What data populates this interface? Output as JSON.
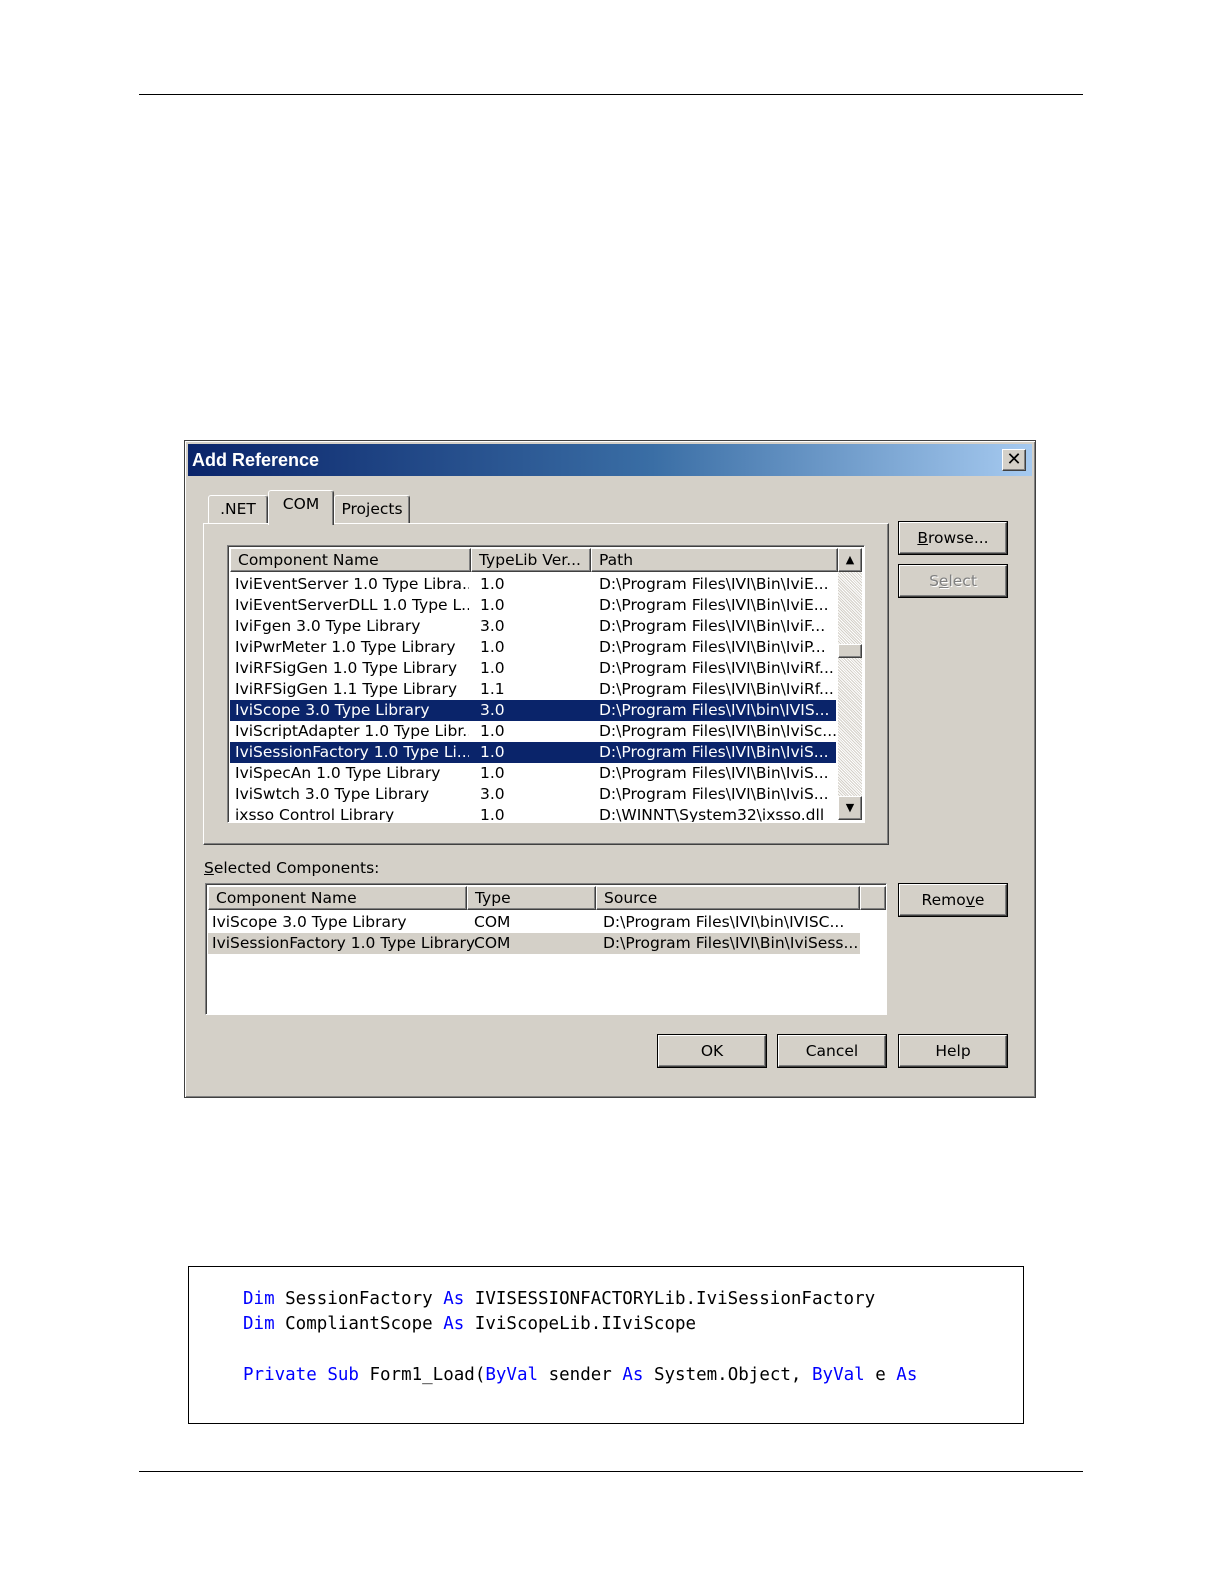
{
  "dialog": {
    "title": "Add Reference",
    "close_glyph": "✕",
    "tabs": [
      {
        "label": ".NET"
      },
      {
        "label": "COM"
      },
      {
        "label": "Projects"
      }
    ],
    "components": {
      "columns": [
        "Component Name",
        "TypeLib Ver...",
        "Path"
      ],
      "rows": [
        {
          "name": "IviEventServer 1.0 Type Libra...",
          "ver": "1.0",
          "path": "D:\\Program Files\\IVI\\Bin\\IviE..."
        },
        {
          "name": "IviEventServerDLL 1.0 Type L...",
          "ver": "1.0",
          "path": "D:\\Program Files\\IVI\\Bin\\IviE..."
        },
        {
          "name": "IviFgen 3.0 Type Library",
          "ver": "3.0",
          "path": "D:\\Program Files\\IVI\\Bin\\IviF..."
        },
        {
          "name": "IviPwrMeter 1.0 Type Library",
          "ver": "1.0",
          "path": "D:\\Program Files\\IVI\\Bin\\IviP..."
        },
        {
          "name": "IviRFSigGen 1.0 Type Library",
          "ver": "1.0",
          "path": "D:\\Program Files\\IVI\\Bin\\IviRf..."
        },
        {
          "name": "IviRFSigGen 1.1 Type Library",
          "ver": "1.1",
          "path": "D:\\Program Files\\IVI\\Bin\\IviRf..."
        },
        {
          "name": "IviScope 3.0 Type Library",
          "ver": "3.0",
          "path": "D:\\Program Files\\IVI\\bin\\IVIS..."
        },
        {
          "name": "IviScriptAdapter 1.0 Type Libr...",
          "ver": "1.0",
          "path": "D:\\Program Files\\IVI\\Bin\\IviSc..."
        },
        {
          "name": "IviSessionFactory 1.0 Type Li...",
          "ver": "1.0",
          "path": "D:\\Program Files\\IVI\\Bin\\IviS..."
        },
        {
          "name": "IviSpecAn 1.0 Type Library",
          "ver": "1.0",
          "path": "D:\\Program Files\\IVI\\Bin\\IviS..."
        },
        {
          "name": "IviSwtch 3.0 Type Library",
          "ver": "3.0",
          "path": "D:\\Program Files\\IVI\\Bin\\IviS..."
        },
        {
          "name": "ixsso Control Library",
          "ver": "1.0",
          "path": "D:\\WINNT\\System32\\ixsso.dll"
        }
      ]
    },
    "selected_label_first": "S",
    "selected_label_rest": "elected Components:",
    "selected": {
      "columns": [
        "Component Name",
        "Type",
        "Source"
      ],
      "rows": [
        {
          "name": "IviScope 3.0 Type Library",
          "type": "COM",
          "source": "D:\\Program Files\\IVI\\bin\\IVISC..."
        },
        {
          "name": "IviSessionFactory 1.0 Type Library",
          "type": "COM",
          "source": "D:\\Program Files\\IVI\\Bin\\IviSess..."
        }
      ]
    },
    "buttons": {
      "browse": {
        "mnemonic": "B",
        "rest": "rowse..."
      },
      "select": {
        "before": "S",
        "mnemonic": "e",
        "rest": "lect"
      },
      "remove": {
        "before": "Remo",
        "mnemonic": "v",
        "rest": "e"
      },
      "ok": "OK",
      "cancel": "Cancel",
      "help": "Help"
    }
  },
  "code": {
    "line1": {
      "kw1": "Dim",
      "t1": " SessionFactory ",
      "kw2": "As",
      "t2": " IVISESSIONFACTORYLib.IviSessionFactory"
    },
    "line2": {
      "kw1": "Dim",
      "t1": " CompliantScope ",
      "kw2": "As",
      "t2": " IviScopeLib.IIviScope"
    },
    "line3": {
      "kw1": "Private",
      "sp1": " ",
      "kw2": "Sub",
      "t1": " Form1_Load(",
      "kw3": "ByVal",
      "t2": " sender ",
      "kw4": "As",
      "t3": " System.Object, ",
      "kw5": "ByVal",
      "t4": " e ",
      "kw6": "As"
    }
  },
  "colors": {
    "selection": "#0a246a",
    "dialog_face": "#d4d0c8",
    "code_keyword": "#0000ff"
  }
}
